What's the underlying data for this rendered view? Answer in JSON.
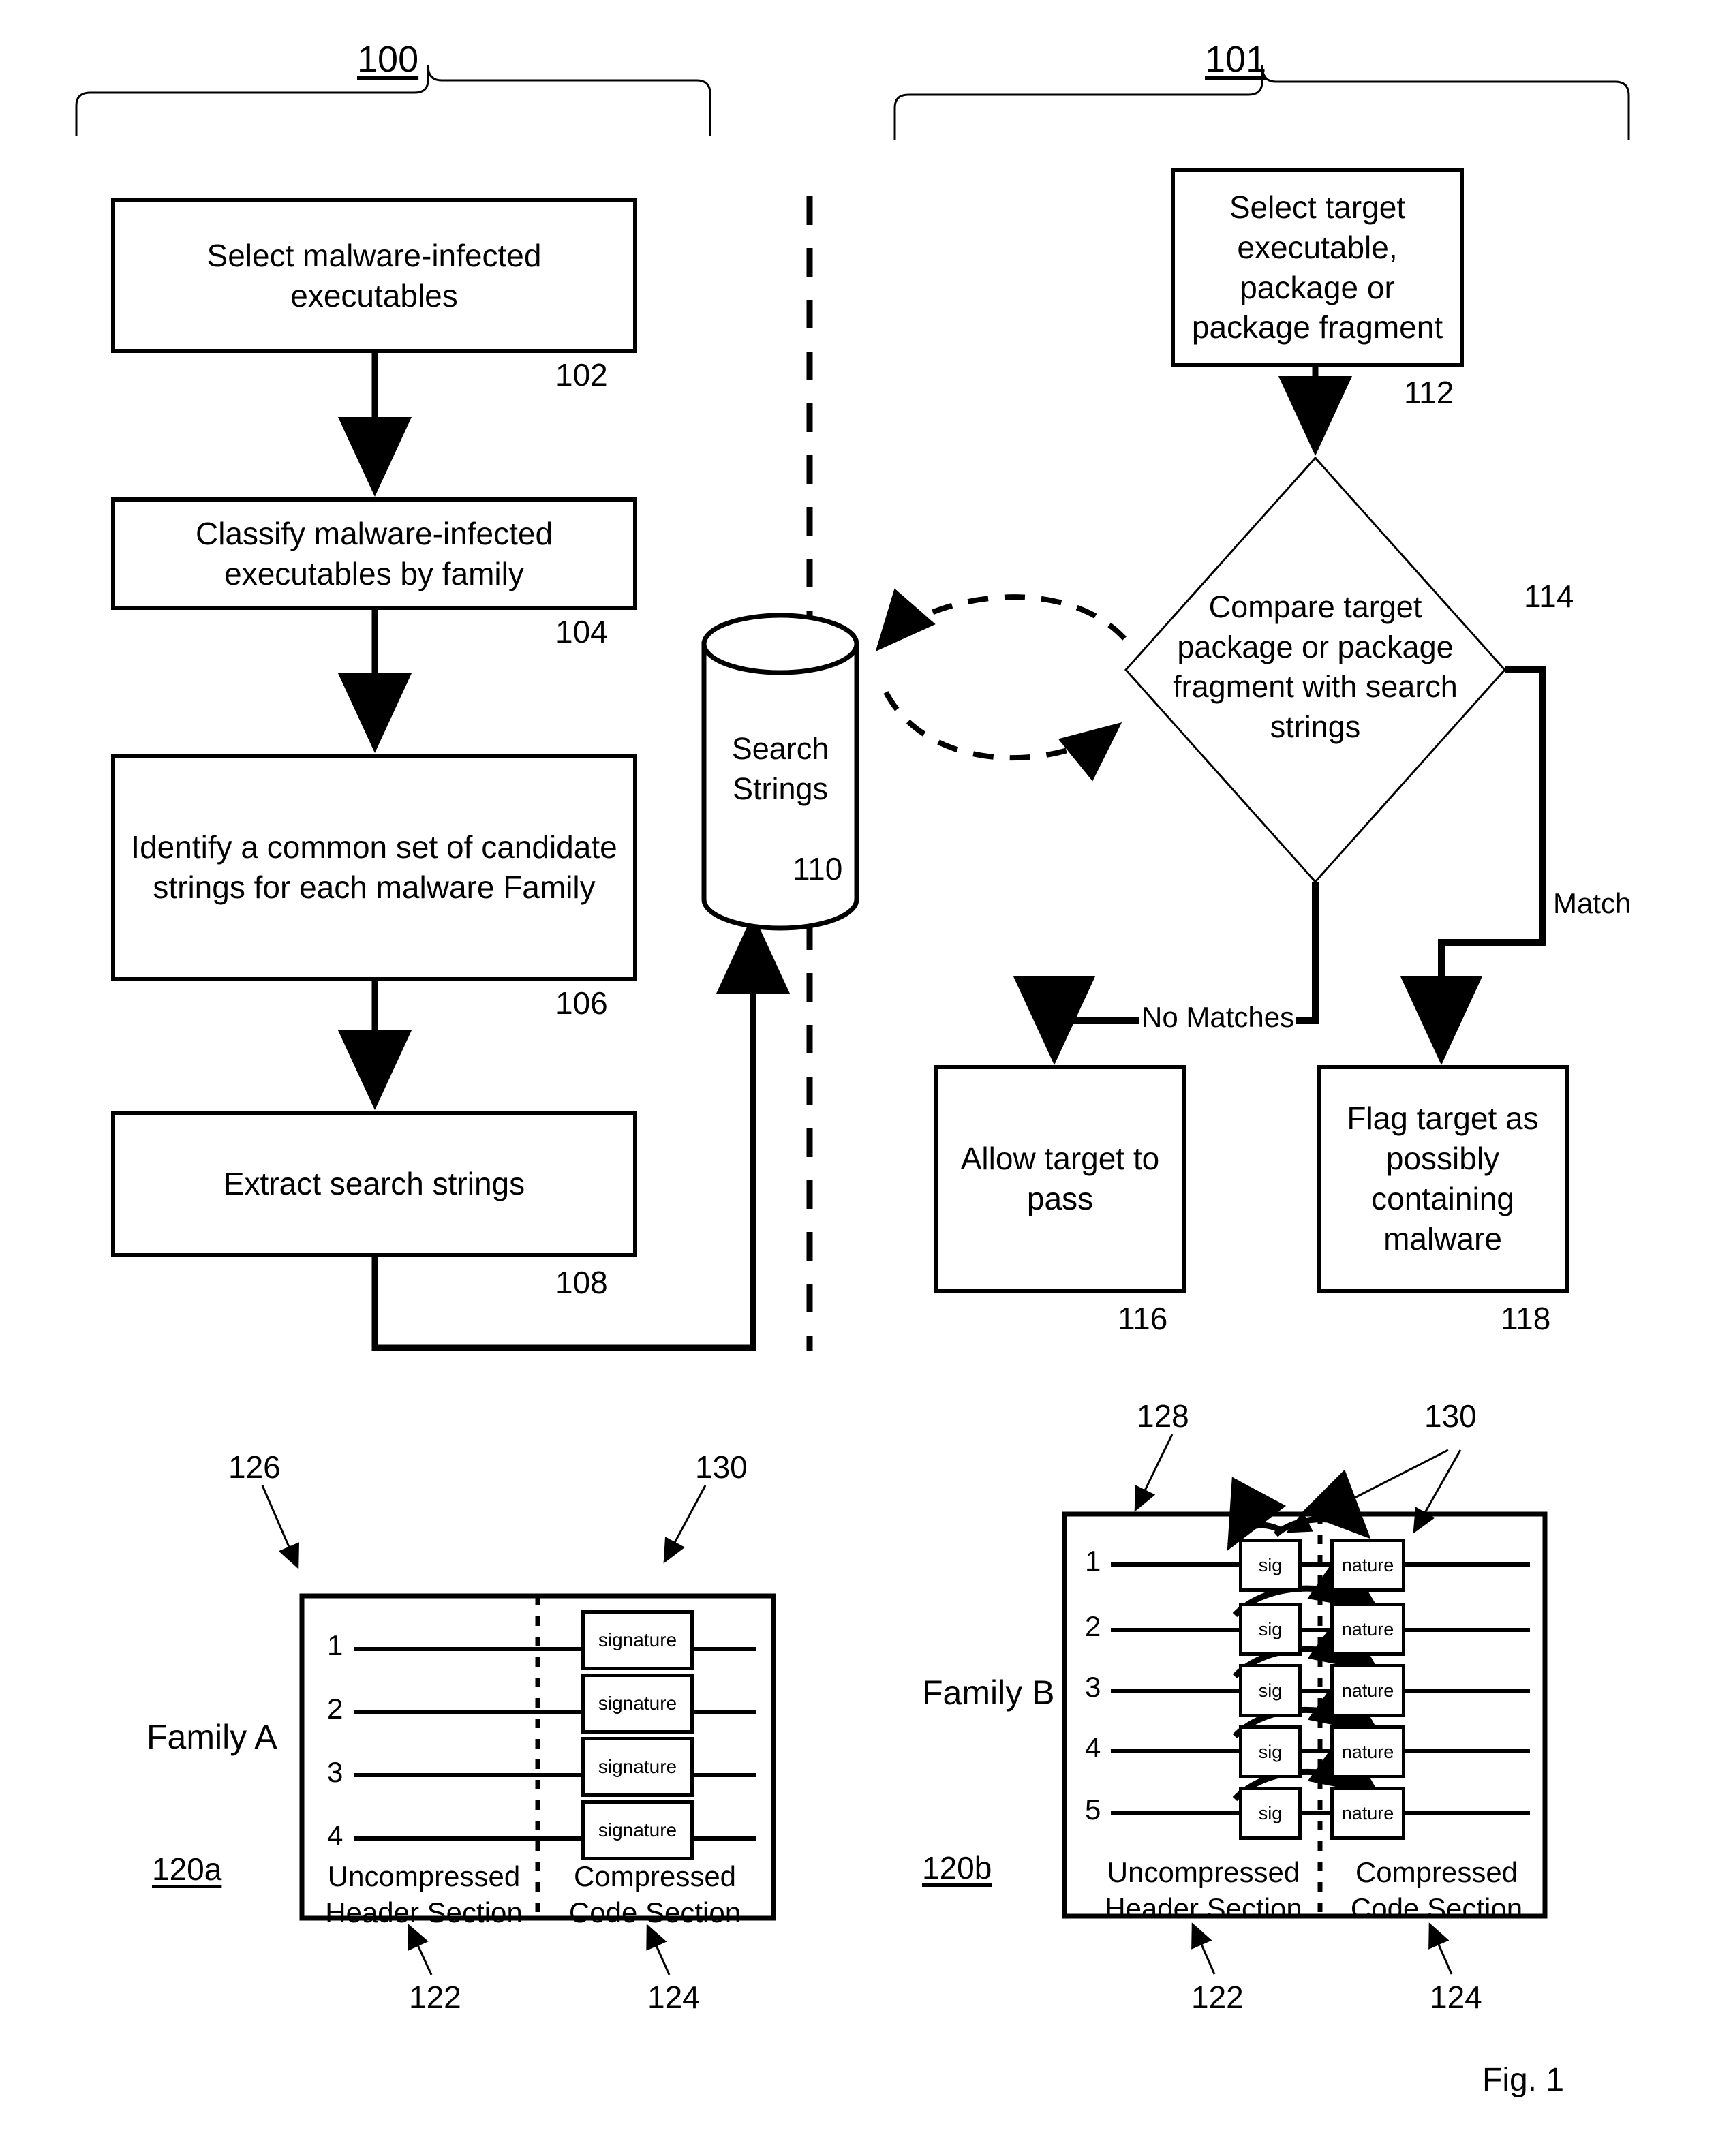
{
  "figure": {
    "caption": "Fig. 1",
    "group_left_ref": "100",
    "group_right_ref": "101"
  },
  "left_flow": {
    "steps": [
      {
        "text": "Select malware-infected executables",
        "ref": "102"
      },
      {
        "text": "Classify malware-infected executables by family",
        "ref": "104"
      },
      {
        "text": "Identify a common set of candidate strings for each malware Family",
        "ref": "106"
      },
      {
        "text": "Extract search strings",
        "ref": "108"
      }
    ]
  },
  "datastore": {
    "label_line1": "Search",
    "label_line2": "Strings",
    "ref": "110"
  },
  "right_flow": {
    "start": {
      "text": "Select target executable, package or package fragment",
      "ref": "112"
    },
    "decision": {
      "text": "Compare target package or package fragment with search strings",
      "ref": "114"
    },
    "branch_no_match_label": "No Matches",
    "branch_match_label": "Match",
    "outcomes": [
      {
        "text": "Allow target to pass",
        "ref": "116"
      },
      {
        "text": "Flag target as possibly containing malware",
        "ref": "118"
      }
    ]
  },
  "family_a": {
    "title": "Family A",
    "ref": "120a",
    "header_ref": "122",
    "code_ref": "124",
    "pointer_ref_header": "126",
    "pointer_ref_signature": "130",
    "header_section_line1": "Uncompressed",
    "header_section_line2": "Header Section",
    "code_section_line1": "Compressed",
    "code_section_line2": "Code Section",
    "rows": [
      {
        "number": "1",
        "box_label": "signature"
      },
      {
        "number": "2",
        "box_label": "signature"
      },
      {
        "number": "3",
        "box_label": "signature"
      },
      {
        "number": "4",
        "box_label": "signature"
      }
    ]
  },
  "family_b": {
    "title": "Family B",
    "ref": "120b",
    "header_ref": "122",
    "code_ref": "124",
    "pointer_ref_header": "128",
    "pointer_ref_signature": "130",
    "header_section_line1": "Uncompressed",
    "header_section_line2": "Header Section",
    "code_section_line1": "Compressed",
    "code_section_line2": "Code Section",
    "rows": [
      {
        "number": "1",
        "sig_label": "sig",
        "nature_label": "nature"
      },
      {
        "number": "2",
        "sig_label": "sig",
        "nature_label": "nature"
      },
      {
        "number": "3",
        "sig_label": "sig",
        "nature_label": "nature"
      },
      {
        "number": "4",
        "sig_label": "sig",
        "nature_label": "nature"
      },
      {
        "number": "5",
        "sig_label": "sig",
        "nature_label": "nature"
      }
    ]
  },
  "colors": {
    "ink": "#000000",
    "paper": "#ffffff"
  }
}
